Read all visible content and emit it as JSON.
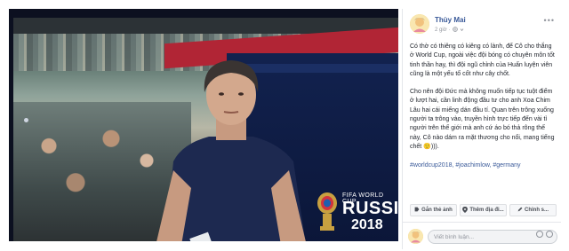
{
  "post": {
    "author": "Thùy Mai",
    "time": "2 giờ",
    "privacy_icon": "globe-icon",
    "paragraphs": [
      "Có thờ có thiêng có kiêng có lành, để Cô cho thắng ở World Cup, ngoài việc đội bóng có chuyên môn tốt tinh thần hay, thì đội ngũ chỉnh của Huấn luyện viên cũng là một yếu tố cốt như cây chốt.",
      "Cho nên đội Đức mà không muốn tiếp tục tuột điểm ở lượt hai, cần linh động đầu tư cho anh Xoa Chim Lâu hai cái miếng dán đầu tí. Quan trên trông xuống người ta trông vào, truyền hình trực tiếp đến vài tỉ người trên thế giới mà anh cứ áo bó thả rông thế này, Cô nào dám ra mặt thương cho nổi, mang tiếng chết 🙂)))."
    ],
    "hashtags": "#worldcup2018, #joachimlow, #germany"
  },
  "photo": {
    "sponsor_small": "FIFA WORLD CUP",
    "sponsor_big": "RUSSIA",
    "sponsor_year": "2018"
  },
  "tools": {
    "tag_label": "Gắn thẻ ảnh",
    "location_label": "Thêm địa đi...",
    "edit_label": "Chỉnh s..."
  },
  "comment": {
    "placeholder": "Viết bình luận..."
  },
  "colors": {
    "link": "#385898",
    "text": "#1d2129",
    "muted": "#90949c"
  }
}
